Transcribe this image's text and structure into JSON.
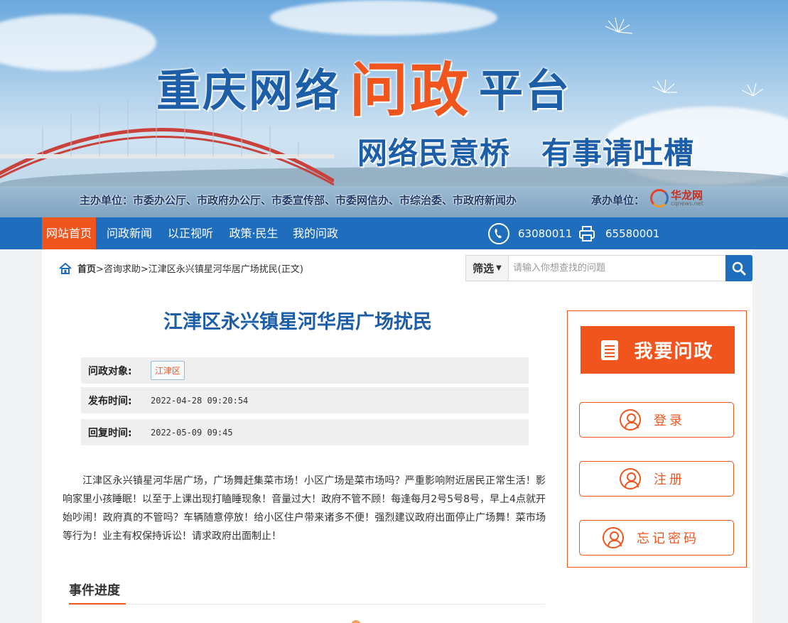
{
  "banner": {
    "title_part1": "重庆网络",
    "title_highlight": "问政",
    "title_part2": "平台",
    "slogan_left": "网络民意桥",
    "slogan_right": "有事请吐槽",
    "sponsor": "主办单位：市委办公厅、市政府办公厅、市委宣传部、市委网信办、市综治委、市政府新闻办",
    "organizer_label": "承办单位：",
    "organizer_logo_cn": "华龙网",
    "organizer_logo_en": "cqnews.net"
  },
  "nav": {
    "items": [
      "网站首页",
      "问政新闻",
      "以正视听",
      "政策·民生",
      "我的问政"
    ],
    "phone": "63080011",
    "fax": "65580001"
  },
  "breadcrumb": {
    "home": "首页",
    "path": ">咨询求助>江津区永兴镇星河华居广场扰民(正文)"
  },
  "search": {
    "filter_label": "筛选",
    "placeholder": "请输入你想查找的问题"
  },
  "article": {
    "title": "江津区永兴镇星河华居广场扰民",
    "target_label": "问政对象:",
    "target_value": "江津区",
    "publish_label": "发布时间:",
    "publish_value": "2022-04-28 09:20:54",
    "reply_label": "回复时间:",
    "reply_value": "2022-05-09 09:45",
    "body": "江津区永兴镇星河华居广场，广场舞赶集菜市场！小区广场是菜市场吗？严重影响附近居民正常生活！影响家里小孩睡眠！以至于上课出现打瞌睡现象！音量过大！政府不管不顾！每逢每月2号5号8号，早上4点就开始吵闹！政府真的不管吗？车辆随意停放！给小区住户带来诸多不便！强烈建议政府出面停止广场舞！菜市场等行为！业主有权保持诉讼！请求政府出面制止！",
    "progress_title": "事件进度"
  },
  "sidebar": {
    "ask_label": "我要问政",
    "login_label": "登录",
    "register_label": "注册",
    "forgot_label": "忘记密码"
  },
  "colors": {
    "brand_blue": "#1f6dbd",
    "accent_orange": "#f0551e",
    "title_blue": "#1d5ea8"
  }
}
